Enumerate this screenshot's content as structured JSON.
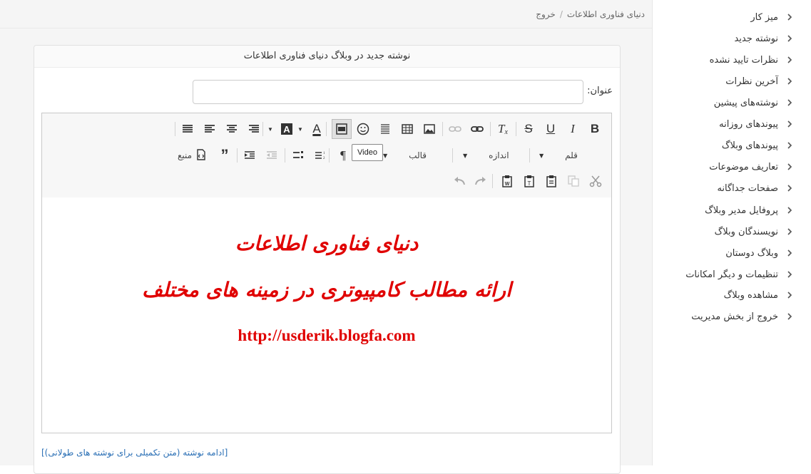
{
  "breadcrumb": {
    "home": "دنیای فناوری اطلاعات",
    "separator": "/",
    "logout": "خروج"
  },
  "sidebar": {
    "items": [
      {
        "label": "میز کار"
      },
      {
        "label": "نوشته جدید"
      },
      {
        "label": "نظرات تایید نشده"
      },
      {
        "label": "آخرین نظرات"
      },
      {
        "label": "نوشته‌های پیشین"
      },
      {
        "label": "پیوندهای روزانه"
      },
      {
        "label": "پیوندهای وبلاگ"
      },
      {
        "label": "تعاریف موضوعات"
      },
      {
        "label": "صفحات جداگانه"
      },
      {
        "label": "پروفایل مدیر وبلاگ"
      },
      {
        "label": "نویسندگان وبلاگ"
      },
      {
        "label": "وبلاگ دوستان"
      },
      {
        "label": "تنظیمات و دیگر امکانات"
      },
      {
        "label": "مشاهده وبلاگ"
      },
      {
        "label": "خروج از بخش مدیریت"
      }
    ]
  },
  "panel": {
    "heading": "نوشته جدید در وبلاگ دنیای فناوری اطلاعات",
    "title_label": "عنوان:",
    "title_value": ""
  },
  "toolbar": {
    "font_label": "قلم",
    "size_label": "اندازه",
    "format_label": "قالب",
    "source_label": "منبع",
    "tooltip": "Video"
  },
  "content": {
    "line1": "دنیای فناوری اطلاعات",
    "line2": "ارائه مطالب کامپیوتری در زمینه های مختلف",
    "url": "http://usderik.blogfa.com"
  },
  "more_link": "[ادامه نوشته (متن تکمیلی برای نوشته های طولانی)]",
  "colors": {
    "content_red": "#e00000",
    "link_blue": "#2a6fb5"
  }
}
